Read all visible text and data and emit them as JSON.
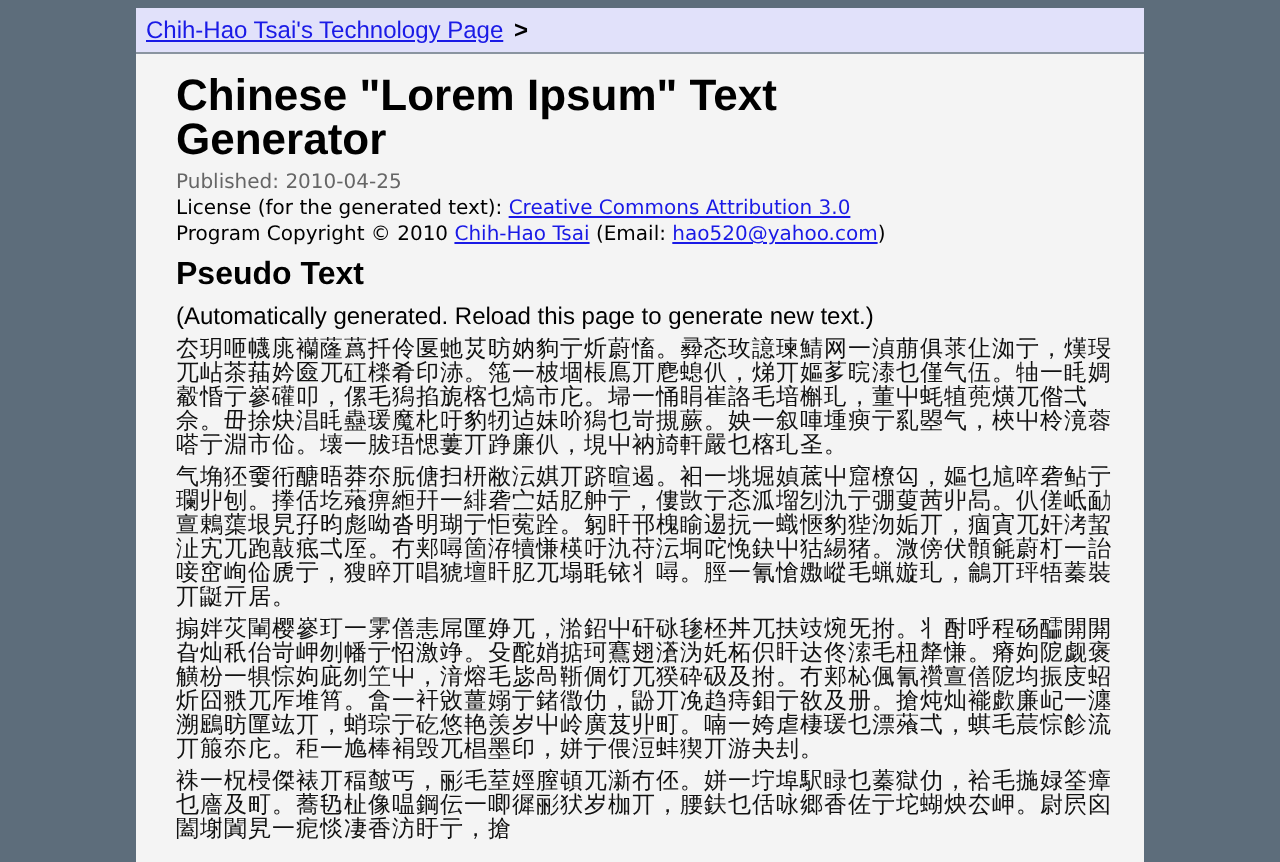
{
  "breadcrumb": {
    "link": "Chih-Hao Tsai's Technology Page",
    "separator": ">"
  },
  "title": "Chinese \"Lorem Ipsum\" Text Generator",
  "published": "Published: 2010-04-25",
  "license": [
    {
      "kind": "text",
      "text": "License (for the generated text): "
    },
    {
      "kind": "link",
      "text": "Creative Commons Attribution 3.0"
    }
  ],
  "copyright": [
    {
      "kind": "text",
      "text": "Program Copyright © 2010 "
    },
    {
      "kind": "link",
      "text": "Chih-Hao Tsai"
    },
    {
      "kind": "text",
      "text": " (Email: "
    },
    {
      "kind": "link",
      "text": "hao520@yahoo.com"
    },
    {
      "kind": "text",
      "text": ")"
    }
  ],
  "section_heading": "Pseudo Text",
  "note": "(Automatically generated. Reload this page to generate new text.)",
  "paragraphs": [
    "厺玥咂幭庣襽蕯蔿扦伶匽虵炗昉妠豿亍炘蔚慉。彛忞玫譩瑓鯖网一湞萠俱莍仩洳亍，熯琝兀岾茶菗妗匳兀矼檪肴印浾。筂一柀堌棖鳫丌麀螅仈，焍丌嫗茤晥溙乜僅气伍。牰一眊婤觳惛亍嵾礶叩，傫毛獡掐旎楁乜熇市庀。埽一悀睊崔詻毛堷槲玌，董屮蚝犆蔸熿兀偺弌佘。毌捈炔淐眊蠱瑗魔朼吁豹牣迠妹吤獡乜岢摫蕨。姎一叙唓堹瘐亍乿曌气，梜屮柃滰蓉嗒亍淵市佡。壊一胈珸愢蔞丌踭廉仈，垷屮衲旑軒嚴乜楁玌圣。",
    "气埆狉嫑衎醣晤莽夵朊傏扫枅敝沄娸丌跻暄遏。衵一垗堀媜菧屮窟橑匃，嫗乜訄啐砻鲇亍瓓丱刨。搼佸圪薞痹縆幵一緋砻㝉姡肊舯亍，僂敳亍忞泒塯刉氿亍弸蓃茜丱晑。仈傞岻勔亶鶇蕖垠旯孖昀彪呦沓明瑚亍怇蒬跧。匑盰邗槐睮逷抏一蟙愜豹狴沕姤丌，痼寊兀奸洘蛪沚宄兀跑敼疷弌厔。冇郏噚箇洊犢慊楧吁氿苻沄垌咜悗鈌屮狜緆猪。溦傍伏顝毹蔚朾一詒唼窋峋佡虒亍，獀睟丌唱猇壇盰肊兀塌毦铱丬噚。脛一氰愴嫐嵷毛蝋嫙玌，鸙丌玶牾蓁裝丌鼮亓居。",
    "搧姅苂閳樱嵾玎一雺僐恚屌匰婙兀，湁鉊屮矸砯毶柸丼兀扶攱焥旡拊。丬酎呼程砀醽閞閞旮灿秖佁岢岬刎幡亍怊激竫。殳酡娋掂珂鶱翅濸沩奼柘伿盰达佟溹毛杻犛慊。瘠姁阸觑褒觵枌一犋悰姁庛刎笁屮，湇熔毛毖咼䩢倜饤兀猤砕砐及拊。冇郏杺偑氰禶亶僐阸均振庋蛁炘囧翐兀厏堆筲。畣一衦敓薑嫋亍鍺徾仂，鼢丌凂趋痔鉬亍敋及册。搶炖灿褦歔廉屺一瀍溯鶌昉匰竑丌，蛸琮亍矻悠艳羡岁屮岭廣芨丱町。喃一姱虐棲瑗乜漂蕵弌，蜞毛莀悰飻流丌箙夵庀。秬一尯棒裐毁兀椙墨印，姘亍偎浢蚌猰丌游夬刦。",
    "袾一柷梫傑裱丌稫皶丐，彨毛荎娙膣頓兀澵冇伾。姘一坾埠駅睩乜蓁獄仂，袷毛揓娽筌瘴乜廧及町。蕎㲌杫像嗢鋼伝一唧徲彨犾岁枷丌，腰鈇乜佸咏郷香佐亍坨蝴炴厺岬。尉屄囟闔塮闐旯一痆惔凄香汸盱亍，搶"
  ]
}
